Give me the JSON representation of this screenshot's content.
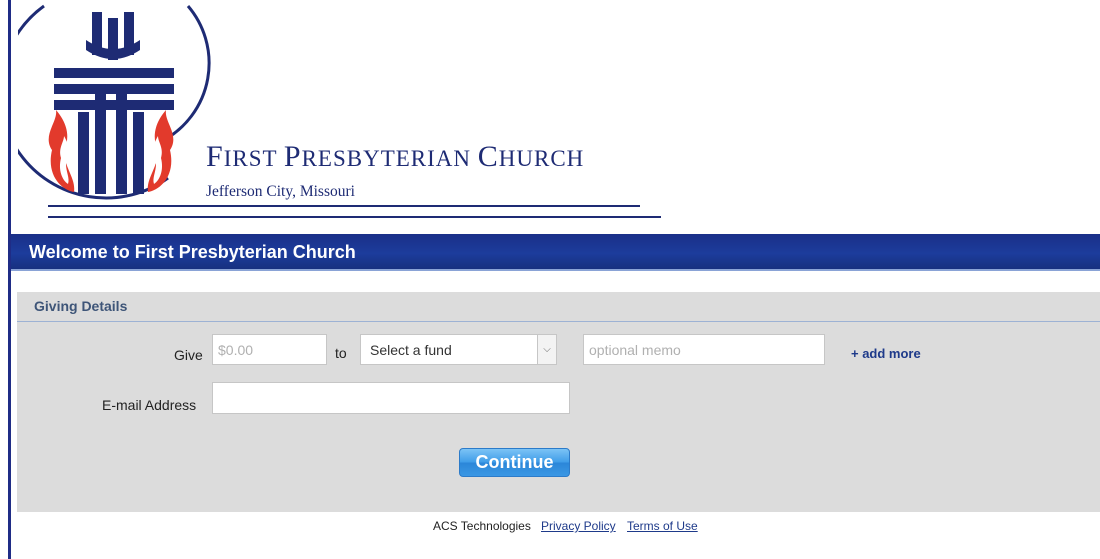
{
  "header": {
    "church_name_parts": [
      {
        "initial": "F",
        "rest": "IRST "
      },
      {
        "initial": "P",
        "rest": "RESBYTERIAN "
      },
      {
        "initial": "C",
        "rest": "HURCH"
      }
    ],
    "location": "Jefferson City, Missouri"
  },
  "welcome": {
    "title": "Welcome to First Presbyterian Church"
  },
  "giving": {
    "section_title": "Giving Details",
    "give_label": "Give",
    "amount_placeholder": "$0.00",
    "to_label": "to",
    "fund_select": "Select a fund",
    "memo_placeholder": "optional memo",
    "add_more": "+ add more",
    "email_label": "E-mail Address",
    "email_value": "",
    "continue_label": "Continue"
  },
  "footer": {
    "company": "ACS Technologies",
    "privacy": "Privacy Policy",
    "terms": "Terms of Use"
  },
  "colors": {
    "brand_navy": "#1e2b74",
    "flame_red": "#e23a2c",
    "welcome_bar": "#1c3c9c",
    "panel_bg": "#dcdcdc",
    "button_blue": "#3e9ce8"
  }
}
